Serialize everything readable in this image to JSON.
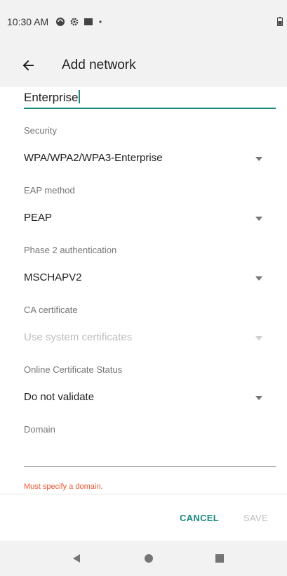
{
  "status_bar": {
    "time": "10:30 AM",
    "icons": [
      "sync-icon",
      "gear-icon",
      "square-icon",
      "dot-icon",
      "battery-icon"
    ]
  },
  "app_bar": {
    "title": "Add network",
    "back_icon": "arrow-left-icon"
  },
  "form": {
    "ssid_value": "Enterprise",
    "security": {
      "label": "Security",
      "value": "WPA/WPA2/WPA3-Enterprise"
    },
    "eap_method": {
      "label": "EAP method",
      "value": "PEAP"
    },
    "phase2": {
      "label": "Phase 2 authentication",
      "value": "MSCHAPV2"
    },
    "ca_certificate": {
      "label": "CA certificate",
      "value": "Use system certificates"
    },
    "online_cert_status": {
      "label": "Online Certificate Status",
      "value": "Do not validate"
    },
    "domain": {
      "label": "Domain",
      "value": "",
      "error": "Must specify a domain."
    }
  },
  "actions": {
    "cancel_label": "CANCEL",
    "save_label": "SAVE"
  },
  "nav_bar": {
    "icons": [
      "back-triangle-icon",
      "home-circle-icon",
      "recents-square-icon"
    ]
  },
  "colors": {
    "accent": "#1a8a7d",
    "error": "#e8542f",
    "disabled_text": "#bdbdbd",
    "label_text": "#757575",
    "bar_background": "#f2f2f2"
  }
}
